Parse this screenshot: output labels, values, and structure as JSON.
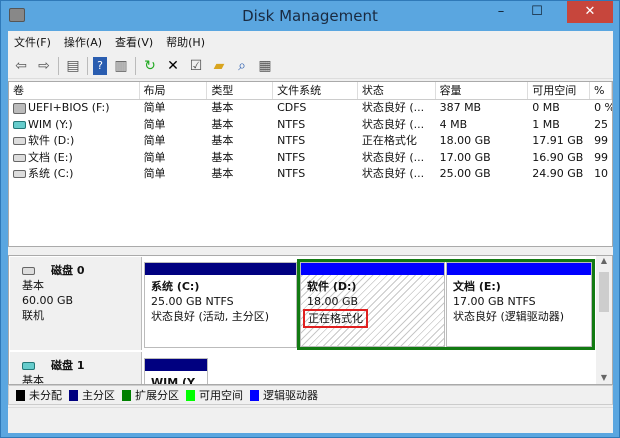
{
  "window": {
    "title": "Disk Management",
    "minimize": "–",
    "maximize": "☐",
    "close": "✕"
  },
  "menu": [
    "文件(F)",
    "操作(A)",
    "查看(V)",
    "帮助(H)"
  ],
  "toolbar": [
    "back",
    "forward",
    "console-tree",
    "help",
    "action-pane",
    "refresh",
    "delete",
    "properties",
    "open",
    "explore",
    "rescan"
  ],
  "table": {
    "columns": [
      "卷",
      "布局",
      "类型",
      "文件系统",
      "状态",
      "容量",
      "可用空间",
      "% "
    ],
    "rows": [
      {
        "icon": "cd",
        "cells": [
          "UEFI+BIOS (F:)",
          "简单",
          "基本",
          "CDFS",
          "状态良好 (...",
          "387 MB",
          "0 MB",
          "0 %"
        ]
      },
      {
        "icon": "wim",
        "cells": [
          "WIM (Y:)",
          "简单",
          "基本",
          "NTFS",
          "状态良好 (...",
          "4 MB",
          "1 MB",
          "25"
        ]
      },
      {
        "icon": "disk",
        "cells": [
          "软件 (D:)",
          "简单",
          "基本",
          "NTFS",
          "正在格式化",
          "18.00 GB",
          "17.91 GB",
          "99"
        ]
      },
      {
        "icon": "disk",
        "cells": [
          "文档 (E:)",
          "简单",
          "基本",
          "NTFS",
          "状态良好 (...",
          "17.00 GB",
          "16.90 GB",
          "99"
        ]
      },
      {
        "icon": "disk",
        "cells": [
          "系统 (C:)",
          "简单",
          "基本",
          "NTFS",
          "状态良好 (...",
          "25.00 GB",
          "24.90 GB",
          "10"
        ]
      }
    ]
  },
  "disks": [
    {
      "name": "磁盘 0",
      "type": "基本",
      "size": "60.00 GB",
      "status": "联机",
      "partitions": [
        {
          "name": "系统  (C:)",
          "size": "25.00 GB NTFS",
          "status": "状态良好 (活动, 主分区)"
        },
        {
          "name": "软件  (D:)",
          "size": "18.00 GB",
          "status": "正在格式化"
        },
        {
          "name": "文档  (E:)",
          "size": "17.00 GB NTFS",
          "status": "状态良好 (逻辑驱动器)"
        }
      ]
    },
    {
      "name": "磁盘 1",
      "type": "基本",
      "partitions": [
        {
          "name": "WIM  (Y"
        }
      ]
    }
  ],
  "legend": [
    {
      "label": "未分配",
      "color": "#000000"
    },
    {
      "label": "主分区",
      "color": "#000080"
    },
    {
      "label": "扩展分区",
      "color": "#008000"
    },
    {
      "label": "可用空间",
      "color": "#00ff00"
    },
    {
      "label": "逻辑驱动器",
      "color": "#0000ff"
    }
  ]
}
